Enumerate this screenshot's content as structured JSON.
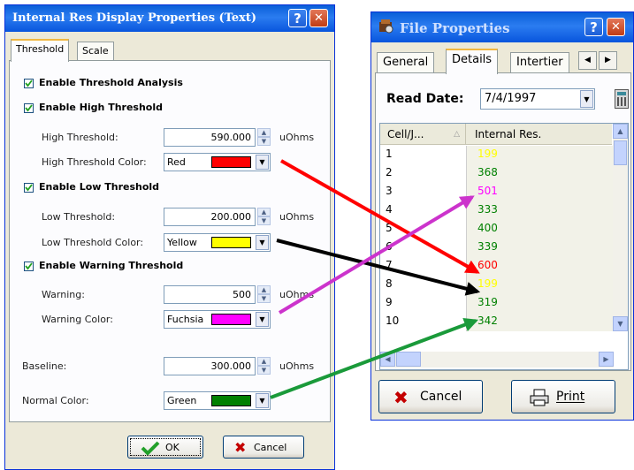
{
  "left": {
    "title": "Internal Res Display Properties (Text)",
    "help": "?",
    "close": "✕",
    "tabs": [
      "Threshold",
      "Scale"
    ],
    "analysis": "Enable Threshold Analysis",
    "high": {
      "section": "Enable High Threshold",
      "label": "High Threshold:",
      "value": "590.000",
      "unit": "uOhms",
      "color_label": "High Threshold Color:",
      "color_name": "Red",
      "swatch": "#ff0000"
    },
    "low": {
      "section": "Enable Low Threshold",
      "label": "Low Threshold:",
      "value": "200.000",
      "unit": "uOhms",
      "color_label": "Low Threshold Color:",
      "color_name": "Yellow",
      "swatch": "#ffff00"
    },
    "warn": {
      "section": "Enable Warning Threshold",
      "label": "Warning:",
      "value": "500",
      "unit": "uOhms",
      "color_label": "Warning Color:",
      "color_name": "Fuchsia",
      "swatch": "#ff00ff"
    },
    "baseline": {
      "label": "Baseline:",
      "value": "300.000",
      "unit": "uOhms"
    },
    "normal": {
      "label": "Normal Color:",
      "color_name": "Green",
      "swatch": "#008000"
    },
    "ok": "OK",
    "cancel": "Cancel"
  },
  "right": {
    "title": "File Properties",
    "help": "?",
    "close": "✕",
    "tabs": [
      "General",
      "Details",
      "Intertier"
    ],
    "read_date_label": "Read Date:",
    "read_date": "7/4/1997",
    "columns": [
      "Cell/J...",
      "Internal Res."
    ],
    "rows": [
      {
        "cell": "1",
        "value": "199",
        "color": "#ffff00"
      },
      {
        "cell": "2",
        "value": "368",
        "color": "#008000"
      },
      {
        "cell": "3",
        "value": "501",
        "color": "#ff00ff"
      },
      {
        "cell": "4",
        "value": "333",
        "color": "#008000"
      },
      {
        "cell": "5",
        "value": "400",
        "color": "#008000"
      },
      {
        "cell": "6",
        "value": "339",
        "color": "#008000"
      },
      {
        "cell": "7",
        "value": "600",
        "color": "#ff0000"
      },
      {
        "cell": "8",
        "value": "199",
        "color": "#ffff00"
      },
      {
        "cell": "9",
        "value": "319",
        "color": "#008000"
      },
      {
        "cell": "10",
        "value": "342",
        "color": "#008000"
      }
    ],
    "cancel": "Cancel",
    "print": "Print"
  },
  "arrow_colors": {
    "red": "#ff0000",
    "black": "#000000",
    "fuchsia": "#cc33cc",
    "green": "#1a9a3a"
  }
}
